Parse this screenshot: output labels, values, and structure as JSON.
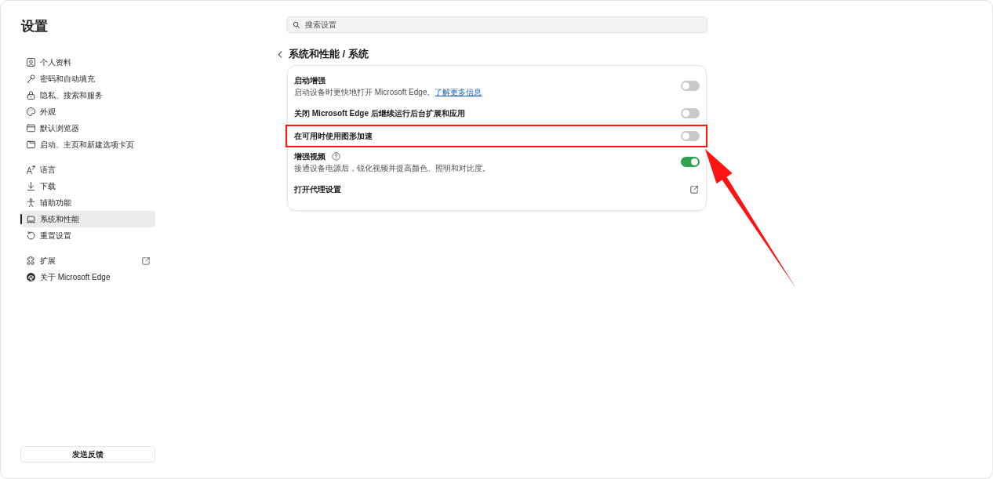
{
  "sidebar": {
    "title": "设置",
    "groups": [
      {
        "items": [
          {
            "label": "个人资料",
            "selected": false,
            "external_link": false
          },
          {
            "label": "密码和自动填充",
            "selected": false,
            "external_link": false
          },
          {
            "label": "隐私、搜索和服务",
            "selected": false,
            "external_link": false
          },
          {
            "label": "外观",
            "selected": false,
            "external_link": false
          },
          {
            "label": "默认浏览器",
            "selected": false,
            "external_link": false
          },
          {
            "label": "启动、主页和新建选项卡页",
            "selected": false,
            "external_link": false
          }
        ]
      },
      {
        "items": [
          {
            "label": "语言",
            "selected": false,
            "external_link": false
          },
          {
            "label": "下载",
            "selected": false,
            "external_link": false
          },
          {
            "label": "辅助功能",
            "selected": false,
            "external_link": false
          },
          {
            "label": "系统和性能",
            "selected": true,
            "external_link": false
          },
          {
            "label": "重置设置",
            "selected": false,
            "external_link": false
          }
        ]
      },
      {
        "items": [
          {
            "label": "扩展",
            "selected": false,
            "external_link": true
          },
          {
            "label": "关于 Microsoft Edge",
            "selected": false,
            "external_link": false
          }
        ]
      }
    ],
    "feedback_button": "发送反馈"
  },
  "search": {
    "placeholder": "搜索设置"
  },
  "page_title": "系统和性能 / 系统",
  "settings": [
    {
      "kind": "toggle",
      "title": "启动增强",
      "help": false,
      "description": "启动设备时更快地打开 Microsoft Edge。",
      "link": "了解更多信息",
      "on": false,
      "highlighted": false
    },
    {
      "kind": "toggle",
      "title": "关闭 Microsoft Edge 后继续运行后台扩展和应用",
      "help": false,
      "on": false,
      "highlighted": false
    },
    {
      "kind": "toggle",
      "title": "在可用时使用图形加速",
      "help": false,
      "on": false,
      "highlighted": true
    },
    {
      "kind": "toggle",
      "title": "增强视频",
      "help": true,
      "description": "接通设备电源后，锐化视频并提高颜色、照明和对比度。",
      "on": true,
      "highlighted": false
    },
    {
      "kind": "link",
      "title": "打开代理设置",
      "highlighted": false
    }
  ]
}
